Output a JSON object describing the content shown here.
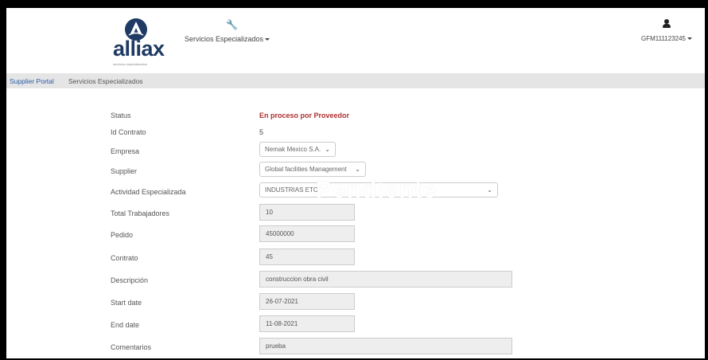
{
  "header": {
    "brand": "alliax",
    "brand_tagline": "servicios especializados",
    "nav_menu_label": "Servicios Especializados",
    "user_label": "GFM111123245",
    "nav_icon": "wrench-icon",
    "user_icon": "user-icon"
  },
  "breadcrumb": {
    "items": [
      "Supplier Portal",
      "Servicios Especializados"
    ]
  },
  "watermark": "Pendiente",
  "form": {
    "status": {
      "label": "Status",
      "value": "En proceso por Proveedor"
    },
    "id_contrato": {
      "label": "Id Contrato",
      "value": "5"
    },
    "empresa": {
      "label": "Empresa",
      "value": "Nemak Mexico S.A."
    },
    "supplier": {
      "label": "Supplier",
      "value": "Global facilities Management"
    },
    "actividad": {
      "label": "Actividad Especializada",
      "value": "INDUSTRIAS ETC"
    },
    "total_trabajadores": {
      "label": "Total Trabajadores",
      "value": "10"
    },
    "pedido": {
      "label": "Pedido",
      "value": "45000000"
    },
    "contrato": {
      "label": "Contrato",
      "value": "45"
    },
    "descripcion": {
      "label": "Descripción",
      "value": "construccion obra civil"
    },
    "start_date": {
      "label": "Start date",
      "value": "26-07-2021"
    },
    "end_date": {
      "label": "End date",
      "value": "11-08-2021"
    },
    "comentarios": {
      "label": "Comentarios",
      "value": "prueba"
    }
  },
  "colors": {
    "brand": "#1f3a64",
    "status": "#b03030",
    "link": "#2a5aa8",
    "breadcrumb_bg": "#e5e5e5"
  }
}
